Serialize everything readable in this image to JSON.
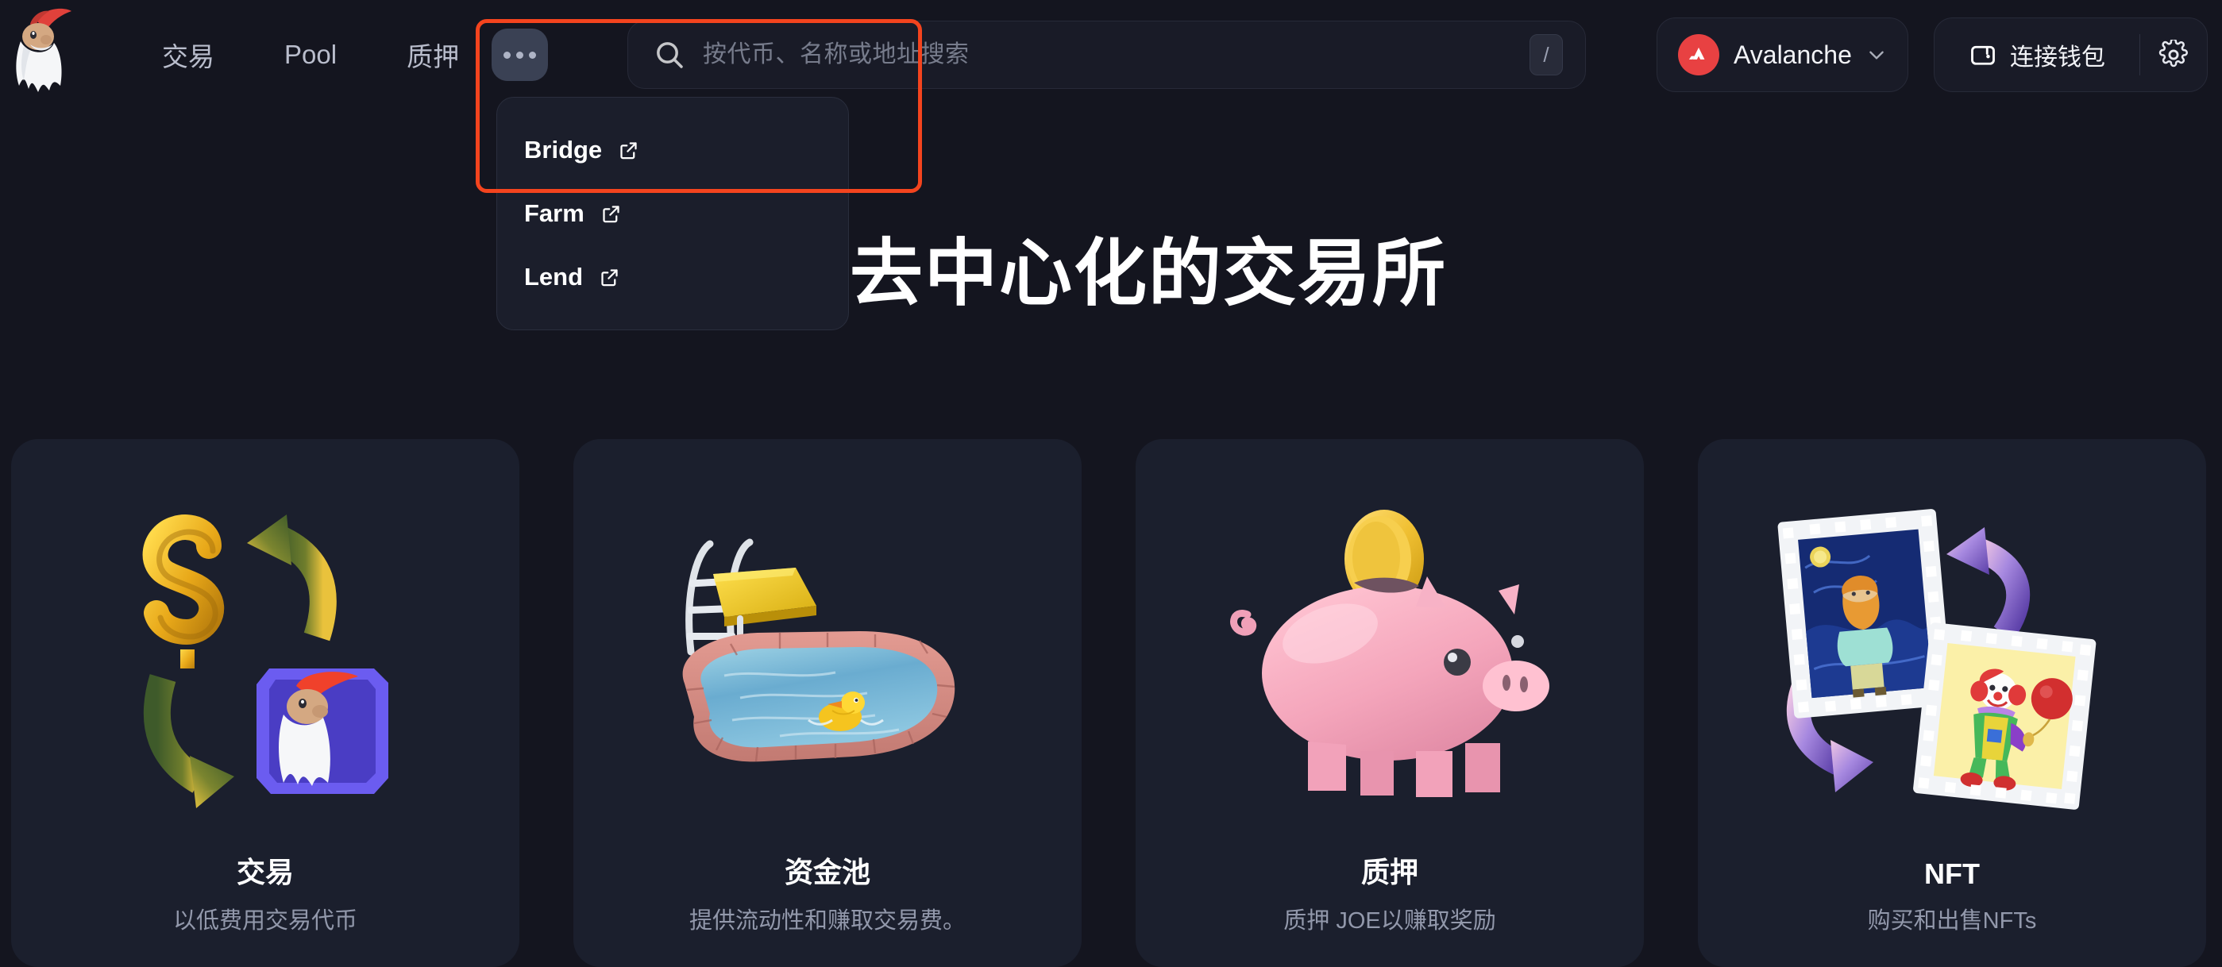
{
  "header": {
    "logo_name": "joe-wizard-logo",
    "nav": [
      {
        "label": "交易",
        "name": "nav-trade"
      },
      {
        "label": "Pool",
        "name": "nav-pool"
      },
      {
        "label": "质押",
        "name": "nav-stake"
      }
    ],
    "more_button_label": "更多",
    "search": {
      "placeholder": "按代币、名称或地址搜索",
      "value": "",
      "shortcut_key": "/",
      "icon": "search-icon"
    },
    "chain": {
      "name": "Avalanche",
      "logo_color": "#e84142",
      "chevron": "chevron-down-icon"
    },
    "wallet": {
      "connect_label": "连接钱包",
      "wallet_icon": "wallet-icon",
      "settings_icon": "gear-icon"
    }
  },
  "dropdown": {
    "visible": true,
    "items": [
      {
        "label": "Bridge",
        "icon": "external-link-icon"
      },
      {
        "label": "Farm",
        "icon": "external-link-icon"
      },
      {
        "label": "Lend",
        "icon": "external-link-icon"
      }
    ]
  },
  "annotation": {
    "highlight_color": "#f4441e"
  },
  "hero": {
    "title": "式去中心化的交易所"
  },
  "cards": [
    {
      "title": "交易",
      "subtitle": "以低费用交易代币",
      "art": "dollar-swap-illustration"
    },
    {
      "title": "资金池",
      "subtitle": "提供流动性和赚取交易费。",
      "art": "swimming-pool-illustration"
    },
    {
      "title": "质押",
      "subtitle": "质押 JOE以赚取奖励",
      "art": "piggy-bank-illustration"
    },
    {
      "title": "NFT",
      "subtitle": "购买和出售NFTs",
      "art": "nft-swap-illustration"
    }
  ],
  "colors": {
    "background": "#14151f",
    "card_background": "#1b1f2d",
    "panel": "#191b27",
    "accent_red": "#e84142",
    "highlight": "#f4441e",
    "text_primary": "#ffffff",
    "text_muted": "#9298ab"
  }
}
